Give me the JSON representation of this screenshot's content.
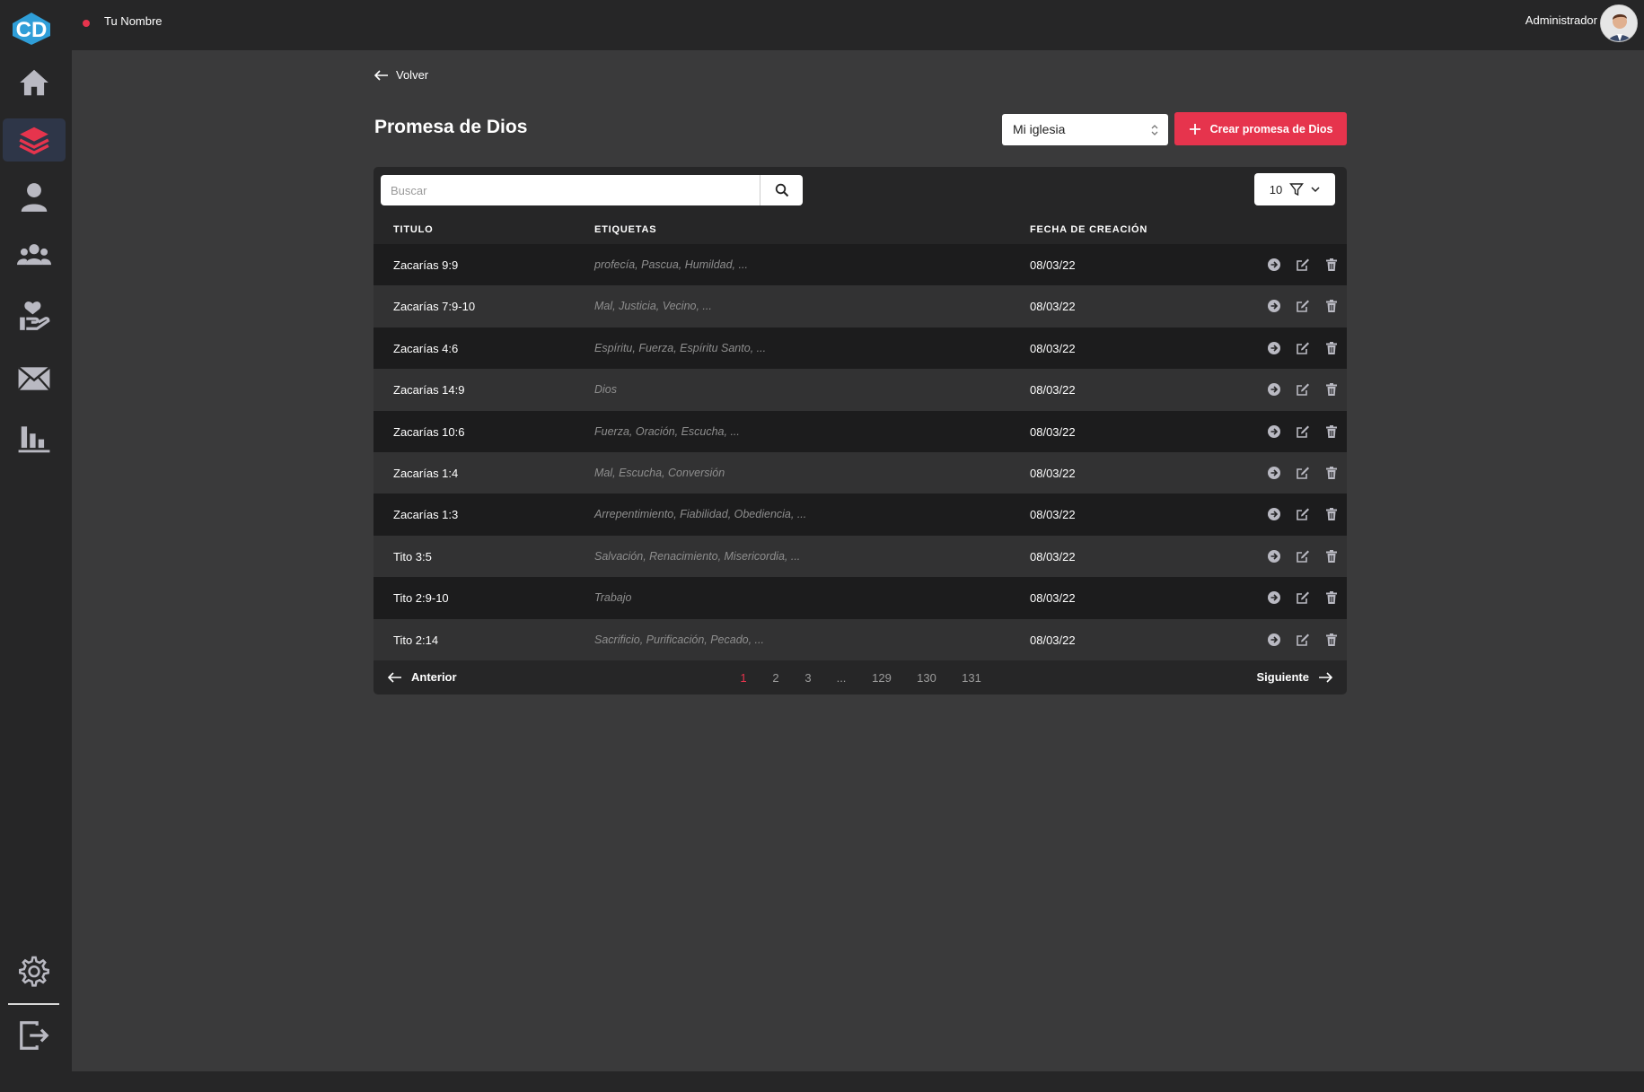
{
  "topbar": {
    "user_name": "Tu Nombre",
    "role": "Administrador"
  },
  "brand": {
    "logo_text": "CD",
    "accent_color": "#e6344d"
  },
  "sidebar": {
    "items": [
      {
        "icon": "home-icon",
        "active": false
      },
      {
        "icon": "layers-icon",
        "active": true
      },
      {
        "icon": "user-icon",
        "active": false
      },
      {
        "icon": "users-icon",
        "active": false
      },
      {
        "icon": "hand-heart-icon",
        "active": false
      },
      {
        "icon": "mail-icon",
        "active": false
      },
      {
        "icon": "bar-chart-icon",
        "active": false
      }
    ],
    "bottom": [
      {
        "icon": "gear-icon"
      },
      {
        "icon": "logout-icon"
      }
    ]
  },
  "main": {
    "back_label": "Volver",
    "title": "Promesa de Dios",
    "church_select": "Mi iglesia",
    "create_label": "Crear promesa de Dios"
  },
  "table": {
    "search_placeholder": "Buscar",
    "page_size": "10",
    "columns": [
      "TITULO",
      "ETIQUETAS",
      "FECHA DE CREACIÓN"
    ],
    "rows": [
      {
        "title": "Zacarías 9:9",
        "tags": "profecía, Pascua, Humildad, ...",
        "date": "08/03/22"
      },
      {
        "title": "Zacarías 7:9-10",
        "tags": "Mal, Justicia, Vecino, ...",
        "date": "08/03/22"
      },
      {
        "title": "Zacarías 4:6",
        "tags": "Espíritu, Fuerza, Espíritu Santo, ...",
        "date": "08/03/22"
      },
      {
        "title": "Zacarías 14:9",
        "tags": "Dios",
        "date": "08/03/22"
      },
      {
        "title": "Zacarías 10:6",
        "tags": "Fuerza, Oración, Escucha, ...",
        "date": "08/03/22"
      },
      {
        "title": "Zacarías 1:4",
        "tags": "Mal, Escucha, Conversión",
        "date": "08/03/22"
      },
      {
        "title": "Zacarías 1:3",
        "tags": "Arrepentimiento, Fiabilidad, Obediencia, ...",
        "date": "08/03/22"
      },
      {
        "title": "Tito 3:5",
        "tags": "Salvación, Renacimiento, Misericordia, ...",
        "date": "08/03/22"
      },
      {
        "title": "Tito 2:9-10",
        "tags": "Trabajo",
        "date": "08/03/22"
      },
      {
        "title": "Tito 2:14",
        "tags": "Sacrificio, Purificación, Pecado, ...",
        "date": "08/03/22"
      }
    ]
  },
  "pagination": {
    "prev_label": "Anterior",
    "next_label": "Siguiente",
    "pages": [
      "1",
      "2",
      "3",
      "...",
      "129",
      "130",
      "131"
    ],
    "current": "1"
  }
}
